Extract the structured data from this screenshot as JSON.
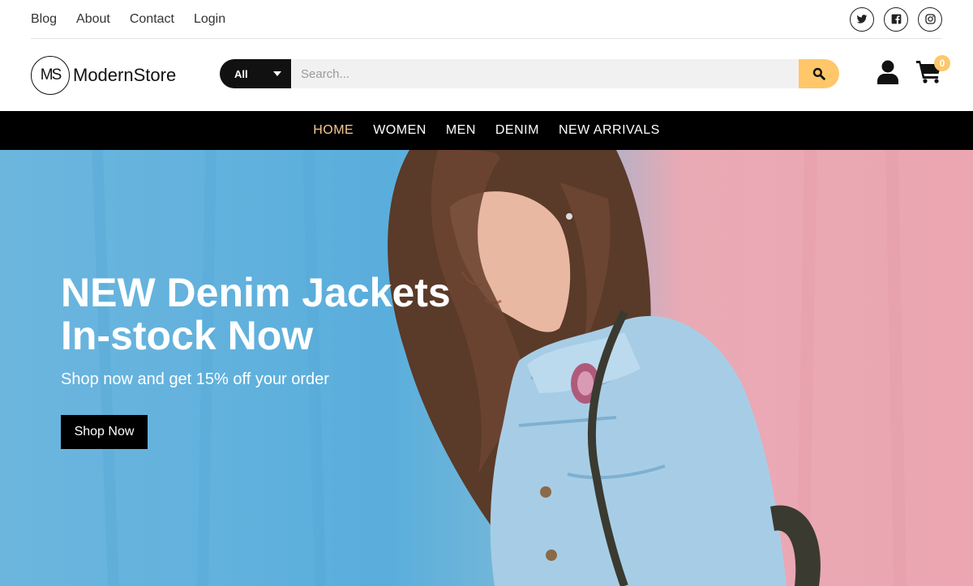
{
  "top_links": [
    "Blog",
    "About",
    "Contact",
    "Login"
  ],
  "social": [
    {
      "name": "twitter-icon"
    },
    {
      "name": "facebook-icon"
    },
    {
      "name": "instagram-icon"
    }
  ],
  "logo": {
    "mark": "MS",
    "name": "ModernStore"
  },
  "search": {
    "category": "All",
    "placeholder": "Search..."
  },
  "cart": {
    "count": "0"
  },
  "nav": [
    {
      "label": "HOME",
      "active": true
    },
    {
      "label": "WOMEN",
      "active": false
    },
    {
      "label": "MEN",
      "active": false
    },
    {
      "label": "DENIM",
      "active": false
    },
    {
      "label": "NEW ARRIVALS",
      "active": false
    }
  ],
  "hero": {
    "title_line1": "NEW Denim Jackets",
    "title_line2": "In-stock Now",
    "subtitle": "Shop now and get 15% off your order",
    "cta": "Shop Now"
  },
  "colors": {
    "accent": "#ffc76a",
    "nav_active": "#f7c894",
    "nav_bg": "#000000",
    "wall_blue": "#5aaedc",
    "wall_pink": "#eba6b1"
  }
}
